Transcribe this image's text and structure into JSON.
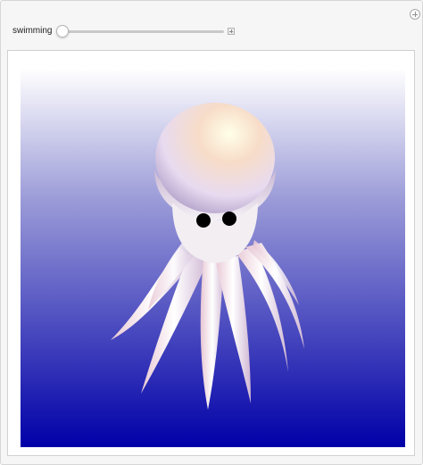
{
  "controls": {
    "slider_label": "swimming",
    "slider_value": 0
  },
  "icons": {
    "add": "plus-circle-icon",
    "expand": "plus-square-icon"
  },
  "colors": {
    "background_top": "#ffffff",
    "background_bottom": "#0000a8",
    "octopus_body": "#f2eef2",
    "octopus_highlight": "#ffe6c6",
    "eyes": "#000000"
  }
}
